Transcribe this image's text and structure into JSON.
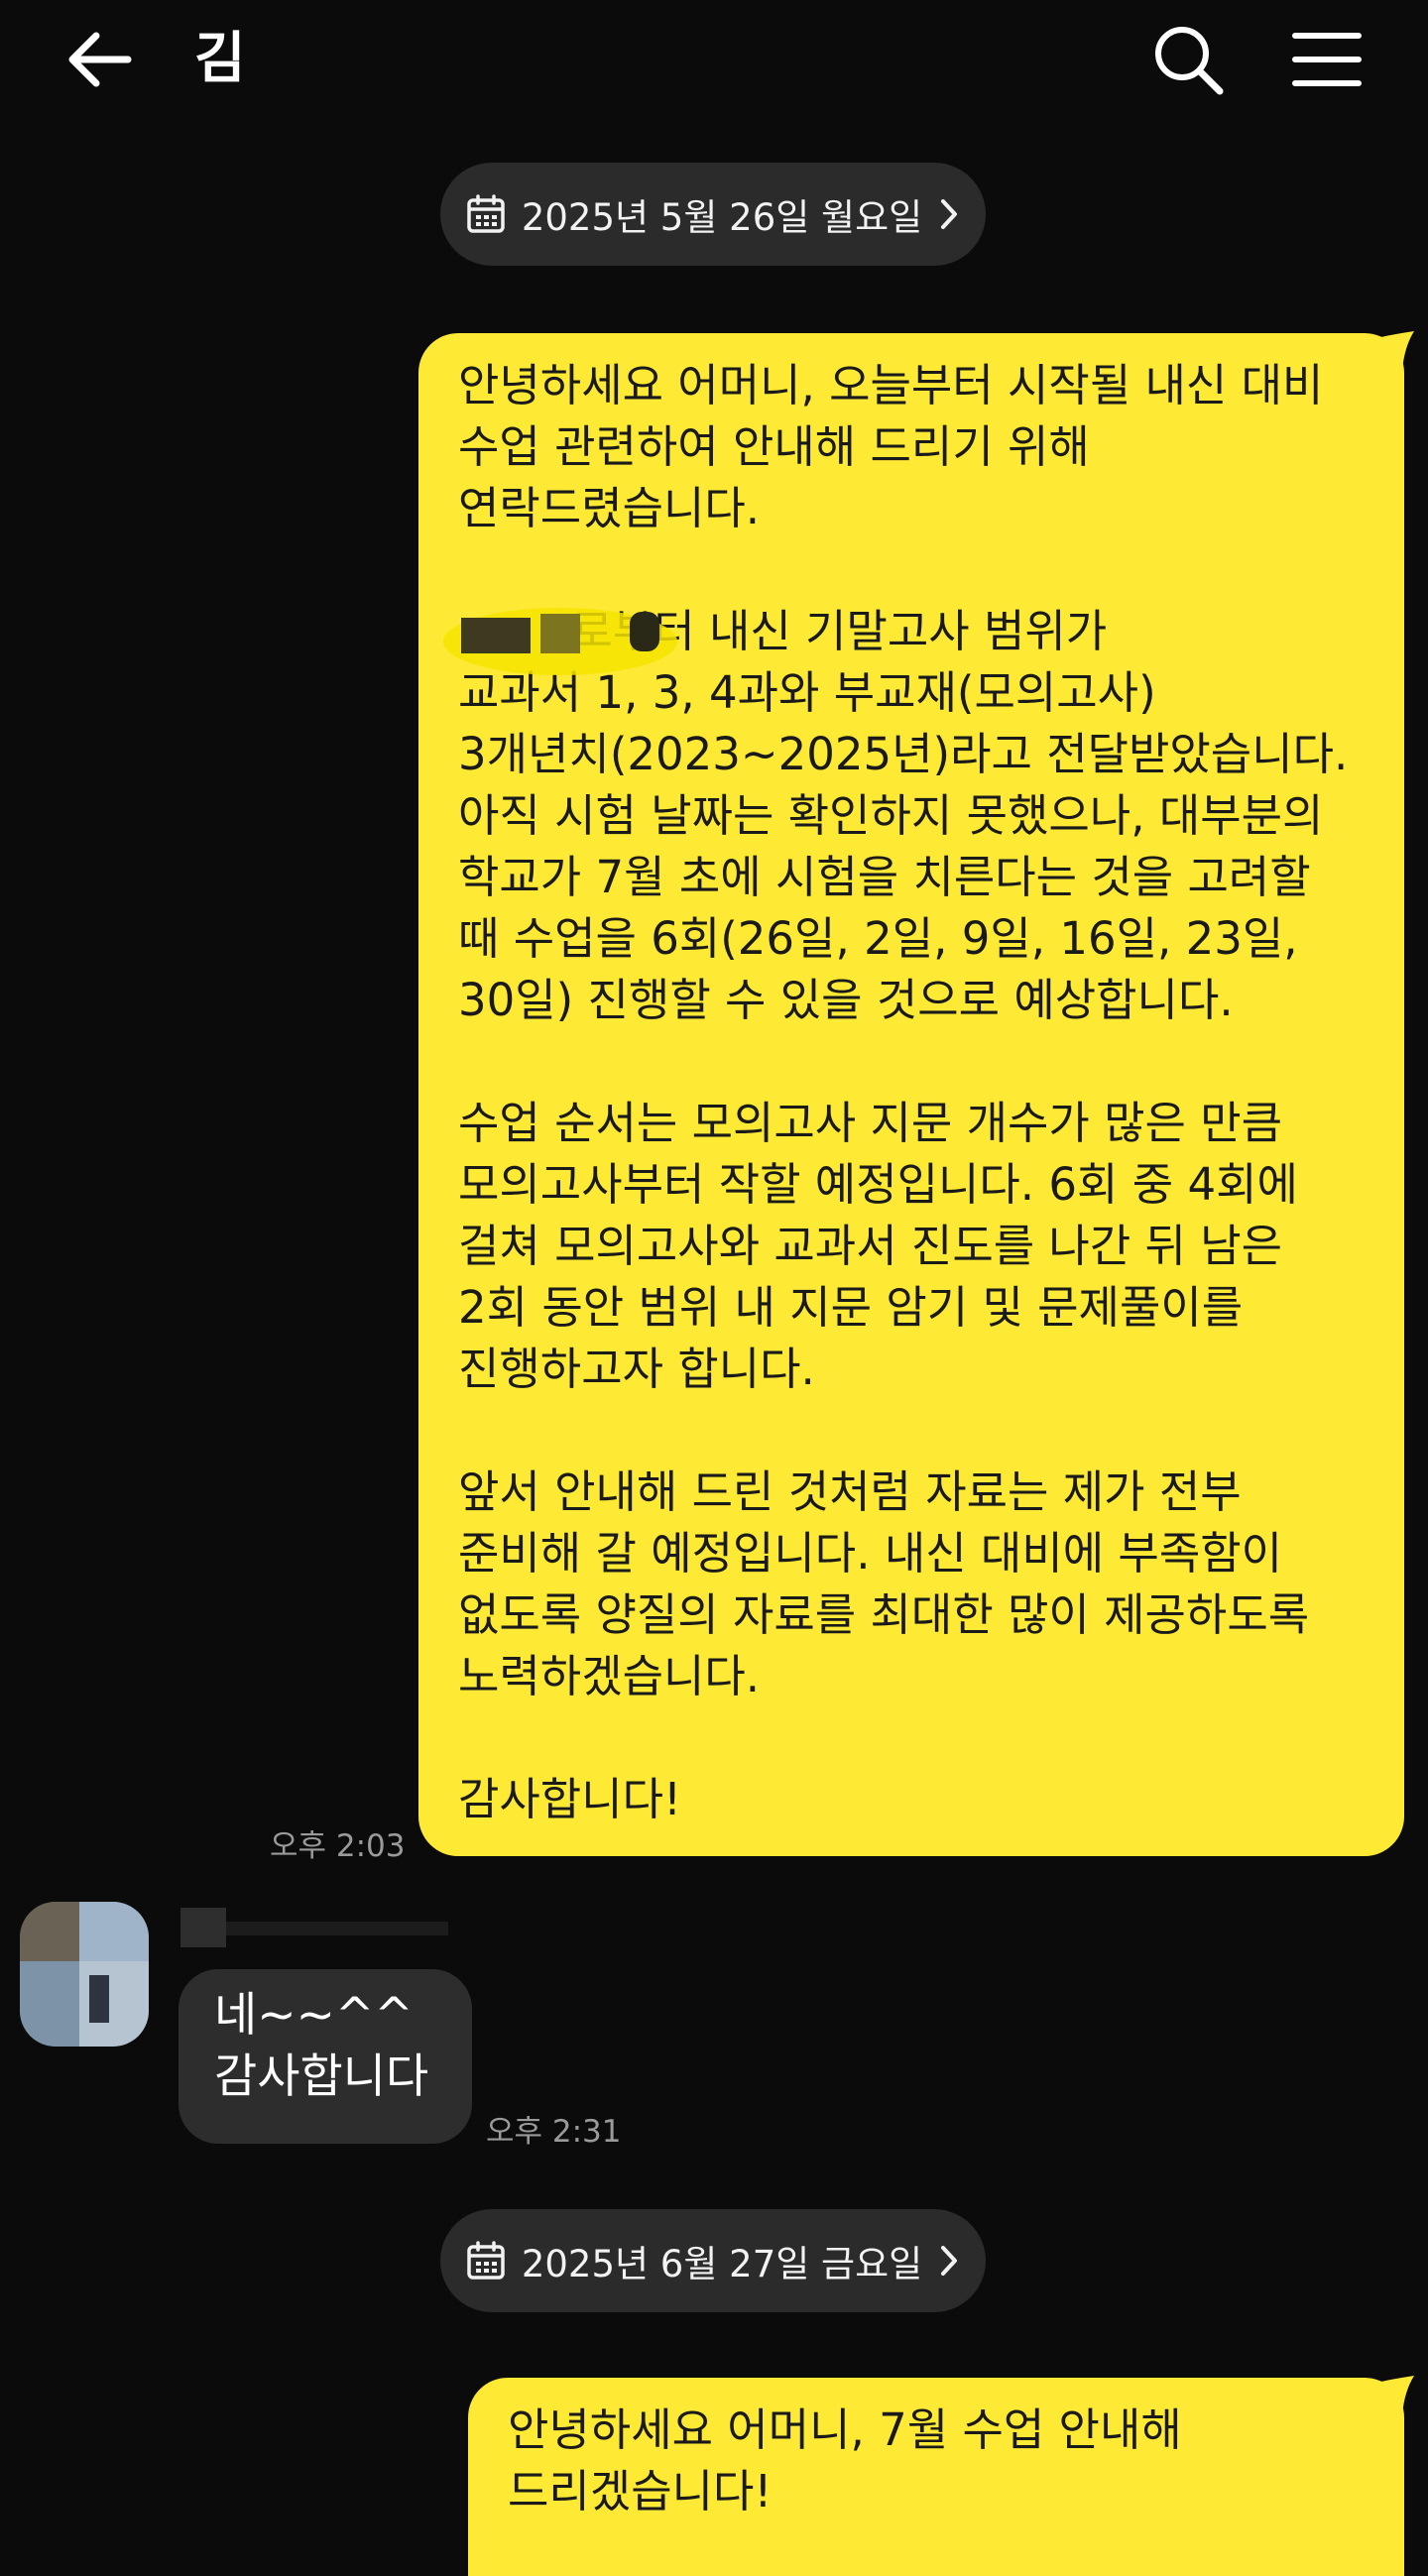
{
  "header": {
    "back_icon": "arrow-left-icon",
    "title": "김",
    "search_icon": "search-icon",
    "menu_icon": "hamburger-menu-icon"
  },
  "colors": {
    "background": "#0b0b0b",
    "outgoing_bubble": "#fee934",
    "incoming_bubble": "#2d2d2d",
    "date_pill": "#2b2b2b"
  },
  "messages": [
    {
      "type": "date",
      "text": "2025년 5월 26일 월요일"
    },
    {
      "type": "outgoing",
      "text": "안녕하세요 어머니, 오늘부터 시작될 내신 대비\n수업 관련하여 안내해 드리기 위해\n연락드렸습니다.\n\n        로부터 내신 기말고사 범위가\n교과서 1, 3, 4과와 부교재(모의고사)\n3개년치(2023~2025년)라고 전달받았습니다.\n아직 시험 날짜는 확인하지 못했으나, 대부분의\n학교가 7월 초에 시험을 치른다는 것을 고려할\n때 수업을 6회(26일, 2일, 9일, 16일, 23일,\n30일) 진행할 수 있을 것으로 예상합니다.\n\n수업 순서는 모의고사 지문 개수가 많은 만큼\n모의고사부터 작할 예정입니다. 6회 중 4회에\n걸쳐 모의고사와 교과서 진도를 나간 뒤 남은\n2회 동안 범위 내 지문 암기 및 문제풀이를\n진행하고자 합니다.\n\n앞서 안내해 드린 것처럼 자료는 제가 전부\n준비해 갈 예정입니다. 내신 대비에 부족함이\n없도록 양질의 자료를 최대한 많이 제공하도록\n노력하겠습니다.\n\n감사합니다!",
      "time": "오후 2:03"
    },
    {
      "type": "incoming",
      "text": "네~~^^\n감사합니다",
      "time": "오후 2:31"
    },
    {
      "type": "date",
      "text": "2025년 6월 27일 금요일"
    },
    {
      "type": "outgoing",
      "text": "안녕하세요 어머니, 7월 수업 안내해\n드리겠습니다!"
    }
  ]
}
